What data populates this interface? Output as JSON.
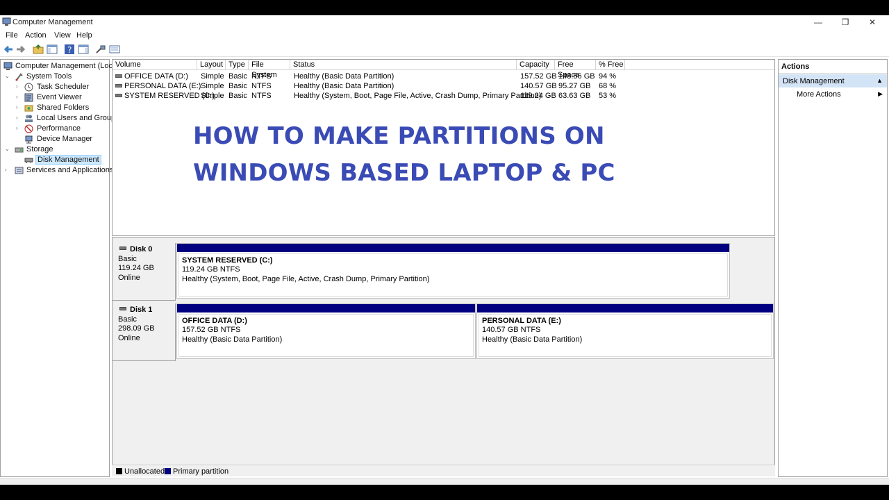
{
  "window": {
    "title": "Computer Management",
    "minimize_glyph": "—",
    "restore_glyph": "❐",
    "close_glyph": "✕"
  },
  "menu": [
    "File",
    "Action",
    "View",
    "Help"
  ],
  "tree": {
    "root": "Computer Management (Local)",
    "system_tools": "System Tools",
    "task_scheduler": "Task Scheduler",
    "event_viewer": "Event Viewer",
    "shared_folders": "Shared Folders",
    "local_users": "Local Users and Groups",
    "performance": "Performance",
    "device_manager": "Device Manager",
    "storage": "Storage",
    "disk_management": "Disk Management",
    "services": "Services and Applications"
  },
  "volumes": {
    "headers": {
      "volume": "Volume",
      "layout": "Layout",
      "type": "Type",
      "fs": "File System",
      "status": "Status",
      "capacity": "Capacity",
      "free": "Free Space",
      "pct": "% Free"
    },
    "rows": [
      {
        "volume": "OFFICE DATA (D:)",
        "layout": "Simple",
        "type": "Basic",
        "fs": "NTFS",
        "status": "Healthy (Basic Data Partition)",
        "capacity": "157.52 GB",
        "free": "148.56 GB",
        "pct": "94 %"
      },
      {
        "volume": "PERSONAL DATA (E:)",
        "layout": "Simple",
        "type": "Basic",
        "fs": "NTFS",
        "status": "Healthy (Basic Data Partition)",
        "capacity": "140.57 GB",
        "free": "95.27 GB",
        "pct": "68 %"
      },
      {
        "volume": "SYSTEM RESERVED (C:)",
        "layout": "Simple",
        "type": "Basic",
        "fs": "NTFS",
        "status": "Healthy (System, Boot, Page File, Active, Crash Dump, Primary Partition)",
        "capacity": "119.24 GB",
        "free": "63.63 GB",
        "pct": "53 %"
      }
    ]
  },
  "overlay": {
    "line1": "HOW TO MAKE PARTITIONS ON",
    "line2": "WINDOWS BASED LAPTOP & PC"
  },
  "disks": [
    {
      "name": "Disk 0",
      "type": "Basic",
      "size": "119.24 GB",
      "state": "Online",
      "partitions": [
        {
          "name": "SYSTEM RESERVED  (C:)",
          "size": "119.24 GB NTFS",
          "status": "Healthy (System, Boot, Page File, Active, Crash Dump, Primary Partition)"
        }
      ]
    },
    {
      "name": "Disk 1",
      "type": "Basic",
      "size": "298.09 GB",
      "state": "Online",
      "partitions": [
        {
          "name": "OFFICE DATA  (D:)",
          "size": "157.52 GB NTFS",
          "status": "Healthy (Basic Data Partition)"
        },
        {
          "name": "PERSONAL DATA  (E:)",
          "size": "140.57 GB NTFS",
          "status": "Healthy (Basic Data Partition)"
        }
      ]
    }
  ],
  "legend": {
    "unallocated": "Unallocated",
    "primary": "Primary partition",
    "unallocated_color": "#000000",
    "primary_color": "#000080"
  },
  "actions": {
    "header": "Actions",
    "section": "Disk Management",
    "more": "More Actions"
  }
}
